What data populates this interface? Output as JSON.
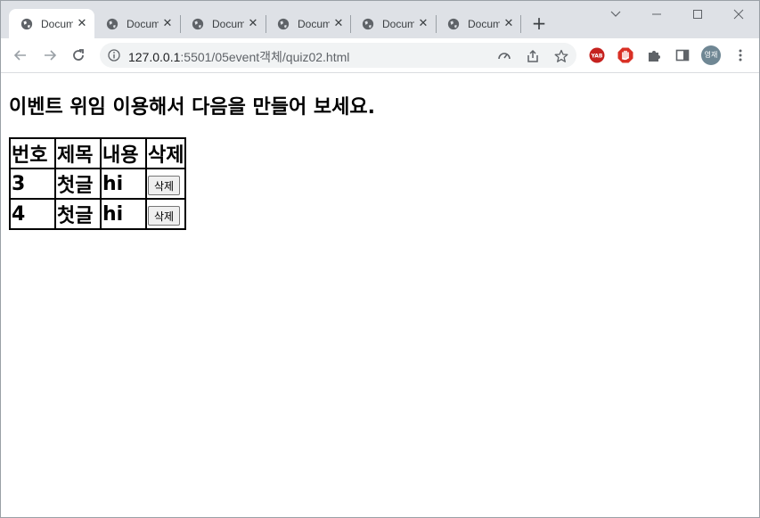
{
  "browser": {
    "tabs": [
      {
        "title": "Document",
        "active": true
      },
      {
        "title": "Document",
        "active": false
      },
      {
        "title": "Document",
        "active": false
      },
      {
        "title": "Document",
        "active": false
      },
      {
        "title": "Document",
        "active": false
      },
      {
        "title": "Document",
        "active": false
      }
    ],
    "new_tab_label": "+",
    "url_host": "127.0.0.1",
    "url_path": ":5501/05event객체/quiz02.html",
    "profile_initials": "영재",
    "ext_yab_label": "YAB"
  },
  "page": {
    "heading": "이벤트 위임 이용해서 다음을 만들어 보세요.",
    "table": {
      "headers": [
        "번호",
        "제목",
        "내용",
        "삭제"
      ],
      "rows": [
        {
          "num": "3",
          "title": "첫글",
          "body": "hi",
          "delete_label": "삭제"
        },
        {
          "num": "4",
          "title": "첫글",
          "body": "hi",
          "delete_label": "삭제"
        }
      ]
    }
  },
  "colors": {
    "tabstrip": "#dee1e6",
    "omnibox": "#f1f3f4",
    "text": "#000000"
  }
}
